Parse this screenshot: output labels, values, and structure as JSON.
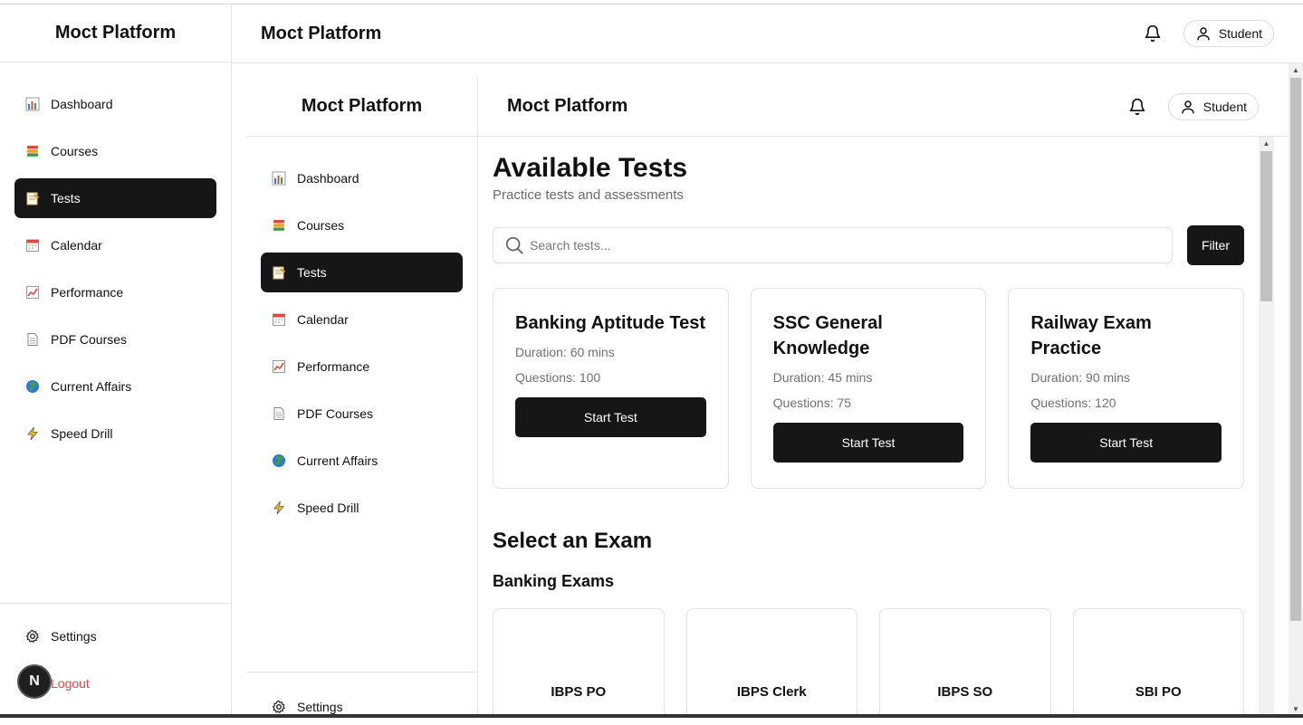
{
  "app": {
    "brand": "Moct Platform",
    "header_title": "Moct Platform",
    "user_label": "Student",
    "n_badge": "N"
  },
  "nav": [
    {
      "label": "Dashboard",
      "icon": "bar-chart-icon"
    },
    {
      "label": "Courses",
      "icon": "books-icon"
    },
    {
      "label": "Tests",
      "icon": "memo-icon",
      "active": true
    },
    {
      "label": "Calendar",
      "icon": "calendar-icon"
    },
    {
      "label": "Performance",
      "icon": "trend-chart-icon"
    },
    {
      "label": "PDF Courses",
      "icon": "document-icon"
    },
    {
      "label": "Current Affairs",
      "icon": "globe-icon"
    },
    {
      "label": "Speed Drill",
      "icon": "lightning-icon"
    }
  ],
  "footer": {
    "settings": "Settings",
    "logout": "Logout"
  },
  "page": {
    "title": "Available Tests",
    "subtitle": "Practice tests and assessments",
    "search_placeholder": "Search tests...",
    "filter_label": "Filter"
  },
  "tests": [
    {
      "title": "Banking Aptitude Test",
      "duration": "Duration: 60 mins",
      "questions": "Questions: 100",
      "button": "Start Test"
    },
    {
      "title": "SSC General Knowledge",
      "duration": "Duration: 45 mins",
      "questions": "Questions: 75",
      "button": "Start Test"
    },
    {
      "title": "Railway Exam Practice",
      "duration": "Duration: 90 mins",
      "questions": "Questions: 120",
      "button": "Start Test"
    }
  ],
  "select_exam": {
    "title": "Select an Exam",
    "group": "Banking Exams",
    "exams": [
      "IBPS PO",
      "IBPS Clerk",
      "IBPS SO",
      "SBI PO"
    ]
  },
  "colors": {
    "active_bg": "#161616",
    "logout": "#e5484d",
    "muted": "#6b6b6b",
    "border": "#e3e3e3"
  }
}
